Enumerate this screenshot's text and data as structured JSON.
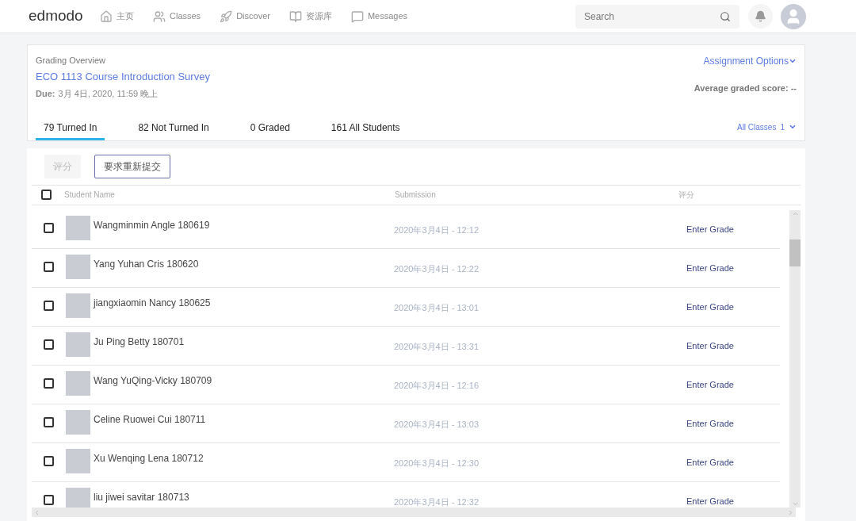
{
  "nav": {
    "logo": "edmodo",
    "items": [
      {
        "kind": "home",
        "label": "主页"
      },
      {
        "kind": "classes",
        "label": "Classes"
      },
      {
        "kind": "discover",
        "label": "Discover"
      },
      {
        "kind": "library",
        "label": "资源库"
      },
      {
        "kind": "messages",
        "label": "Messages"
      }
    ],
    "search": {
      "placeholder": "Search"
    }
  },
  "overview": {
    "label": "Grading Overview",
    "title": "ECO 1113 Course Introduction Survey",
    "due_label": "Due:",
    "due": "3月 4日, 2020, 11:59 晚上",
    "options": "Assignment Options",
    "average": "Average graded score: --",
    "tabs": [
      {
        "label": "79 Turned In",
        "selected": true
      },
      {
        "label": "82 Not Turned In",
        "selected": false
      },
      {
        "label": "0 Graded",
        "selected": false
      },
      {
        "label": "161 All Students",
        "selected": false
      }
    ],
    "class_filter": {
      "label": "All Classes",
      "count": "1"
    }
  },
  "actions": [
    {
      "label": "评分",
      "disabled": true
    },
    {
      "label": "要求重新提交",
      "disabled": false
    }
  ],
  "table": {
    "select_all": {
      "checked": false
    },
    "columns": [
      "Student Name",
      "Submission",
      "评分"
    ],
    "rows": [
      {
        "name": "Wangminmin Angle 180619",
        "submission": "2020年3月4日 - 12:12",
        "grade": "Enter Grade",
        "checked": false
      },
      {
        "name": "Yang Yuhan Cris 180620",
        "submission": "2020年3月4日 - 12:22",
        "grade": "Enter Grade",
        "checked": false
      },
      {
        "name": "jiangxiaomin Nancy 180625",
        "submission": "2020年3月4日 - 13:01",
        "grade": "Enter Grade",
        "checked": false
      },
      {
        "name": "Ju Ping Betty 180701",
        "submission": "2020年3月4日 - 13:31",
        "grade": "Enter Grade",
        "checked": false
      },
      {
        "name": "Wang YuQing-Vicky 180709",
        "submission": "2020年3月4日 - 12:16",
        "grade": "Enter Grade",
        "checked": false
      },
      {
        "name": "Celine Ruowei Cui 180711",
        "submission": "2020年3月4日 - 13:03",
        "grade": "Enter Grade",
        "checked": false
      },
      {
        "name": "Xu Wenqing Lena 180712",
        "submission": "2020年3月4日 - 12:30",
        "grade": "Enter Grade",
        "checked": false
      },
      {
        "name": "liu jiwei savitar 180713",
        "submission": "2020年3月4日 - 12:32",
        "grade": "Enter Grade",
        "checked": false
      }
    ]
  }
}
